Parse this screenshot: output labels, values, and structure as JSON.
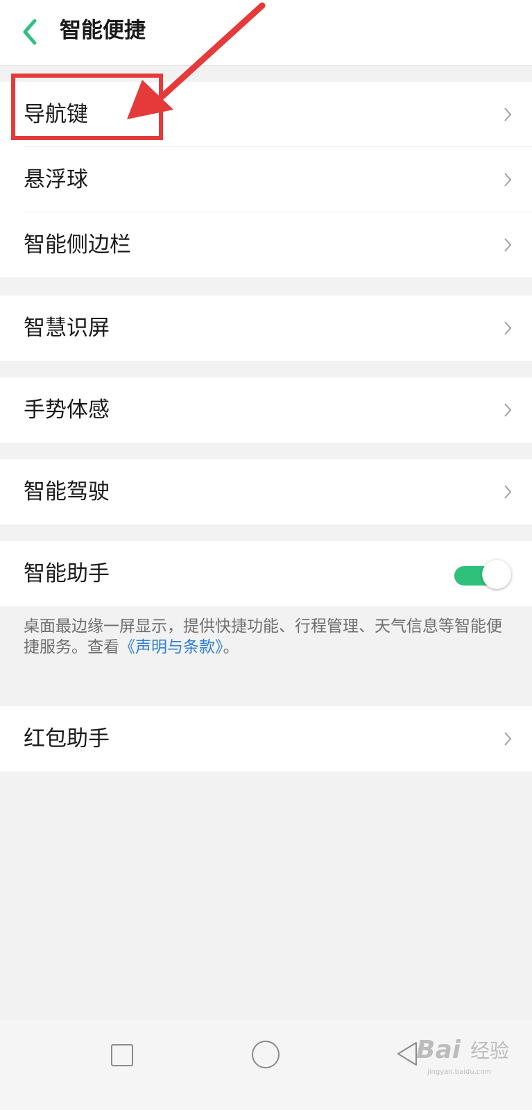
{
  "header": {
    "title": "智能便捷",
    "back_icon": "chevron-left-icon",
    "accent_color": "#2ec17b"
  },
  "groups": {
    "group1": [
      "导航键",
      "悬浮球",
      "智能侧边栏"
    ],
    "group2": [
      "智慧识屏"
    ],
    "group3": [
      "手势体感"
    ],
    "group4": [
      "智能驾驶"
    ],
    "group5": [
      "智能助手"
    ],
    "group6": [
      "红包助手"
    ]
  },
  "assistant": {
    "toggle_on": true,
    "description": "桌面最边缘一屏显示，提供快捷功能、行程管理、天气信息等智能便捷服务。查看",
    "link_text": "《声明与条款》",
    "description_end": "。",
    "link_color": "#2f80d1"
  },
  "annotation": {
    "color": "#e53a3a",
    "target": "导航键"
  },
  "navbar": {
    "recent_icon": "square-icon",
    "home_icon": "circle-icon",
    "back_icon": "triangle-back-icon"
  },
  "watermark": {
    "brand": "Bai",
    "text": "经验",
    "domain": "jingyan.baidu.com"
  }
}
